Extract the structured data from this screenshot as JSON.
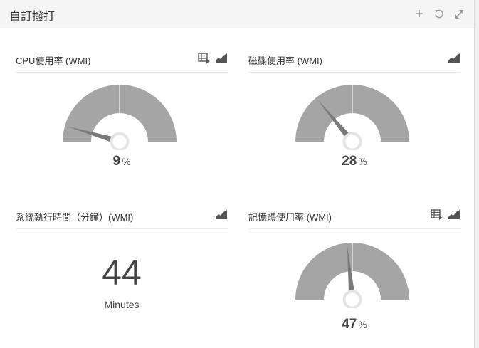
{
  "panel": {
    "title": "自訂撥打",
    "icons": [
      "plus-icon",
      "refresh-icon",
      "expand-icon"
    ]
  },
  "widgets": {
    "cpu": {
      "title": "CPU使用率 (WMI)",
      "value": "9",
      "unit": "%",
      "percent": 9,
      "icons": [
        "table-view-icon",
        "area-chart-icon"
      ]
    },
    "disk": {
      "title": "磁碟使用率 (WMI)",
      "value": "28",
      "unit": "%",
      "percent": 28,
      "icons": [
        "area-chart-icon"
      ]
    },
    "uptime": {
      "title": "系統執行時間（分鐘）(WMI)",
      "value": "44",
      "unit": "Minutes",
      "icons": [
        "area-chart-icon"
      ]
    },
    "memory": {
      "title": "記憶體使用率 (WMI)",
      "value": "47",
      "unit": "%",
      "percent": 47,
      "icons": [
        "table-view-icon",
        "area-chart-icon"
      ]
    }
  },
  "colors": {
    "gauge_fill": "#a5a5a5",
    "needle": "#7a7a7a",
    "hub": "#e4e4e4"
  }
}
